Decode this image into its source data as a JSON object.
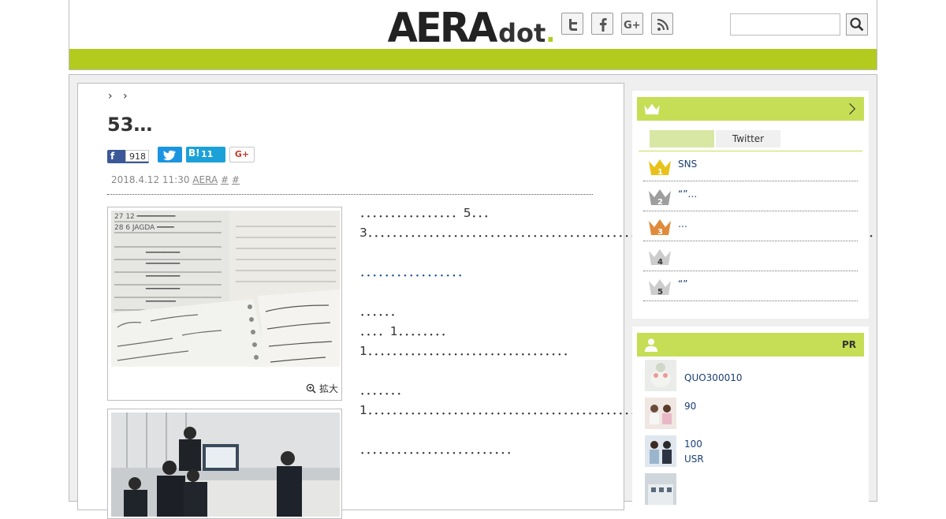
{
  "header": {
    "logo_big": "AERA",
    "logo_small": "dot",
    "logo_dot": "."
  },
  "article": {
    "crumb_sep1": "›",
    "crumb_sep2": "›",
    "title": "53…",
    "share": {
      "fb_label": "f",
      "fb_count": "918",
      "hatena_label": "B!",
      "hatena_count": "11",
      "gplus_label": "G+"
    },
    "date": "2018.4.12 11:30",
    "author": "AERA",
    "tag1": "#",
    "tag2": "#",
    "enlarge_label": "拡大",
    "paragraphs": [
      "．．．．．．．．．．．．．．．．5．．．3．．．．．．．．．．．．．．．．．．．．．．．．．．．．．．．．．．．．．．．．．．．．．．．．．．．．．．．．．．．．．．．．．．．．．．．．．．．．．．．．．．．",
      "．．．．．．．．．．．．．．．．．",
      "．．．．．．\n．．．．1．．．．．．．．1．．．．．．．．．．．．．．．．．．．．．．．．．．．．．．．．．",
      "．．．．．．．1．．．．．．．．．．．．．．．．．．．．．．．．．．．．．．．．．．．．．．．．．．．．．．",
      "．．．．．．．．．．．．．．．．．．．．．．．．．"
    ]
  },
  "sidebar": {
    "ranking": {
      "tab_active": "",
      "tab_twitter": "Twitter",
      "items": [
        {
          "rank": "1",
          "text": "SNS"
        },
        {
          "rank": "2",
          "text": "“”…"
        },
        {
          "rank": "3",
          "text": "…"
        },
        {
          "rank": "4",
          "text": ""
        },
        {
          "rank": "5",
          "text": "“”"
        }
      ]
    },
    "pr": {
      "label": "PR",
      "items": [
        {
          "text": "QUO300010"
        },
        {
          "text": "90"
        },
        {
          "text": "100\nUSR"
        },
        {
          "text": ""
        }
      ]
    }
  },
  "colors": {
    "brand_green": "#b3cb1f",
    "sidebar_green": "#c6de55",
    "gold": "#e8c21a",
    "silver": "#9e9e9e",
    "bronze": "#e08a3c",
    "gray": "#cccccc"
  }
}
